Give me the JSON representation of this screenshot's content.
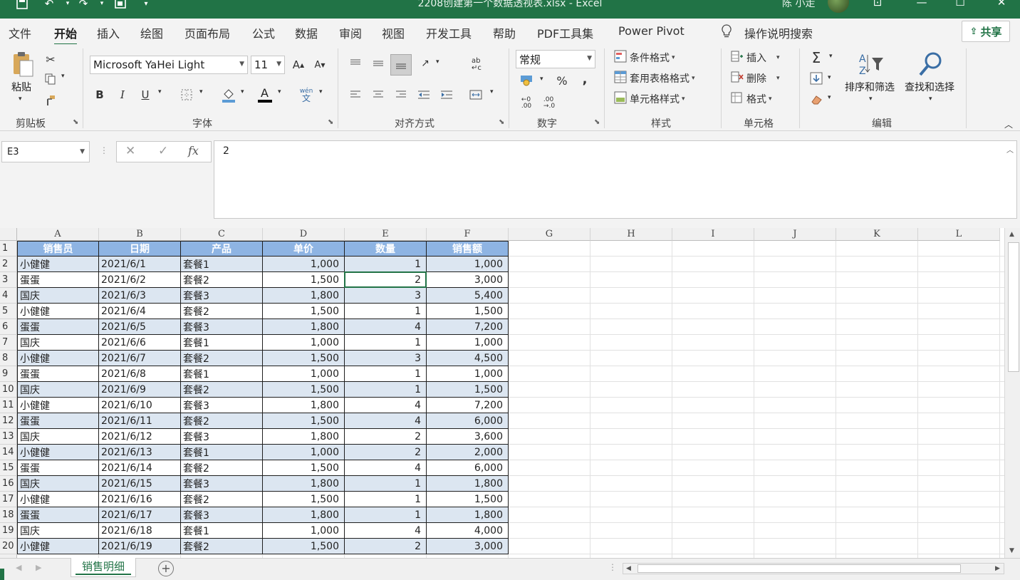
{
  "window": {
    "title": "2208创建第一个数据透视表.xlsx  -  Excel",
    "user": "陈 小走"
  },
  "menu": {
    "tabs": [
      "文件",
      "开始",
      "插入",
      "绘图",
      "页面布局",
      "公式",
      "数据",
      "审阅",
      "视图",
      "开发工具",
      "帮助",
      "PDF工具集",
      "Power Pivot"
    ],
    "active": "开始",
    "search": "操作说明搜索",
    "share": "共享"
  },
  "ribbon": {
    "clipboard": {
      "paste": "粘贴",
      "label": "剪贴板"
    },
    "font": {
      "name": "Microsoft YaHei Light",
      "size": "11",
      "bold": "B",
      "italic": "I",
      "underline": "U",
      "label": "字体",
      "phonetic": "wén"
    },
    "alignment": {
      "label": "对齐方式"
    },
    "number": {
      "format": "常规",
      "label": "数字",
      "percent": "%",
      "comma": ","
    },
    "styles": {
      "conditional": "条件格式",
      "table": "套用表格格式",
      "cell": "单元格样式",
      "label": "样式"
    },
    "cells": {
      "insert": "插入",
      "delete": "删除",
      "format": "格式",
      "label": "单元格"
    },
    "editing": {
      "sort": "排序和筛选",
      "find": "查找和选择",
      "label": "编辑",
      "sum": "Σ"
    }
  },
  "formula_bar": {
    "name_box": "E3",
    "value": "2",
    "fx": "fx"
  },
  "sheet": {
    "columns": [
      "A",
      "B",
      "C",
      "D",
      "E",
      "F",
      "G",
      "H",
      "I",
      "J",
      "K",
      "L"
    ],
    "header": [
      "销售员",
      "日期",
      "产品",
      "单价",
      "数量",
      "销售额"
    ],
    "rows": [
      [
        "小健健",
        "2021/6/1",
        "套餐1",
        "1,000",
        "1",
        "1,000"
      ],
      [
        "蛋蛋",
        "2021/6/2",
        "套餐2",
        "1,500",
        "2",
        "3,000"
      ],
      [
        "国庆",
        "2021/6/3",
        "套餐3",
        "1,800",
        "3",
        "5,400"
      ],
      [
        "小健健",
        "2021/6/4",
        "套餐2",
        "1,500",
        "1",
        "1,500"
      ],
      [
        "蛋蛋",
        "2021/6/5",
        "套餐3",
        "1,800",
        "4",
        "7,200"
      ],
      [
        "国庆",
        "2021/6/6",
        "套餐1",
        "1,000",
        "1",
        "1,000"
      ],
      [
        "小健健",
        "2021/6/7",
        "套餐2",
        "1,500",
        "3",
        "4,500"
      ],
      [
        "蛋蛋",
        "2021/6/8",
        "套餐1",
        "1,000",
        "1",
        "1,000"
      ],
      [
        "国庆",
        "2021/6/9",
        "套餐2",
        "1,500",
        "1",
        "1,500"
      ],
      [
        "小健健",
        "2021/6/10",
        "套餐3",
        "1,800",
        "4",
        "7,200"
      ],
      [
        "蛋蛋",
        "2021/6/11",
        "套餐2",
        "1,500",
        "4",
        "6,000"
      ],
      [
        "国庆",
        "2021/6/12",
        "套餐3",
        "1,800",
        "2",
        "3,600"
      ],
      [
        "小健健",
        "2021/6/13",
        "套餐1",
        "1,000",
        "2",
        "2,000"
      ],
      [
        "蛋蛋",
        "2021/6/14",
        "套餐2",
        "1,500",
        "4",
        "6,000"
      ],
      [
        "国庆",
        "2021/6/15",
        "套餐3",
        "1,800",
        "1",
        "1,800"
      ],
      [
        "小健健",
        "2021/6/16",
        "套餐2",
        "1,500",
        "1",
        "1,500"
      ],
      [
        "蛋蛋",
        "2021/6/17",
        "套餐3",
        "1,800",
        "1",
        "1,800"
      ],
      [
        "国庆",
        "2021/6/18",
        "套餐1",
        "1,000",
        "4",
        "4,000"
      ],
      [
        "小健健",
        "2021/6/19",
        "套餐2",
        "1,500",
        "2",
        "3,000"
      ]
    ],
    "tab": "销售明细"
  },
  "colors": {
    "accent": "#217346",
    "header_fill": "#8eb4e3",
    "band_fill": "#dce6f1"
  }
}
